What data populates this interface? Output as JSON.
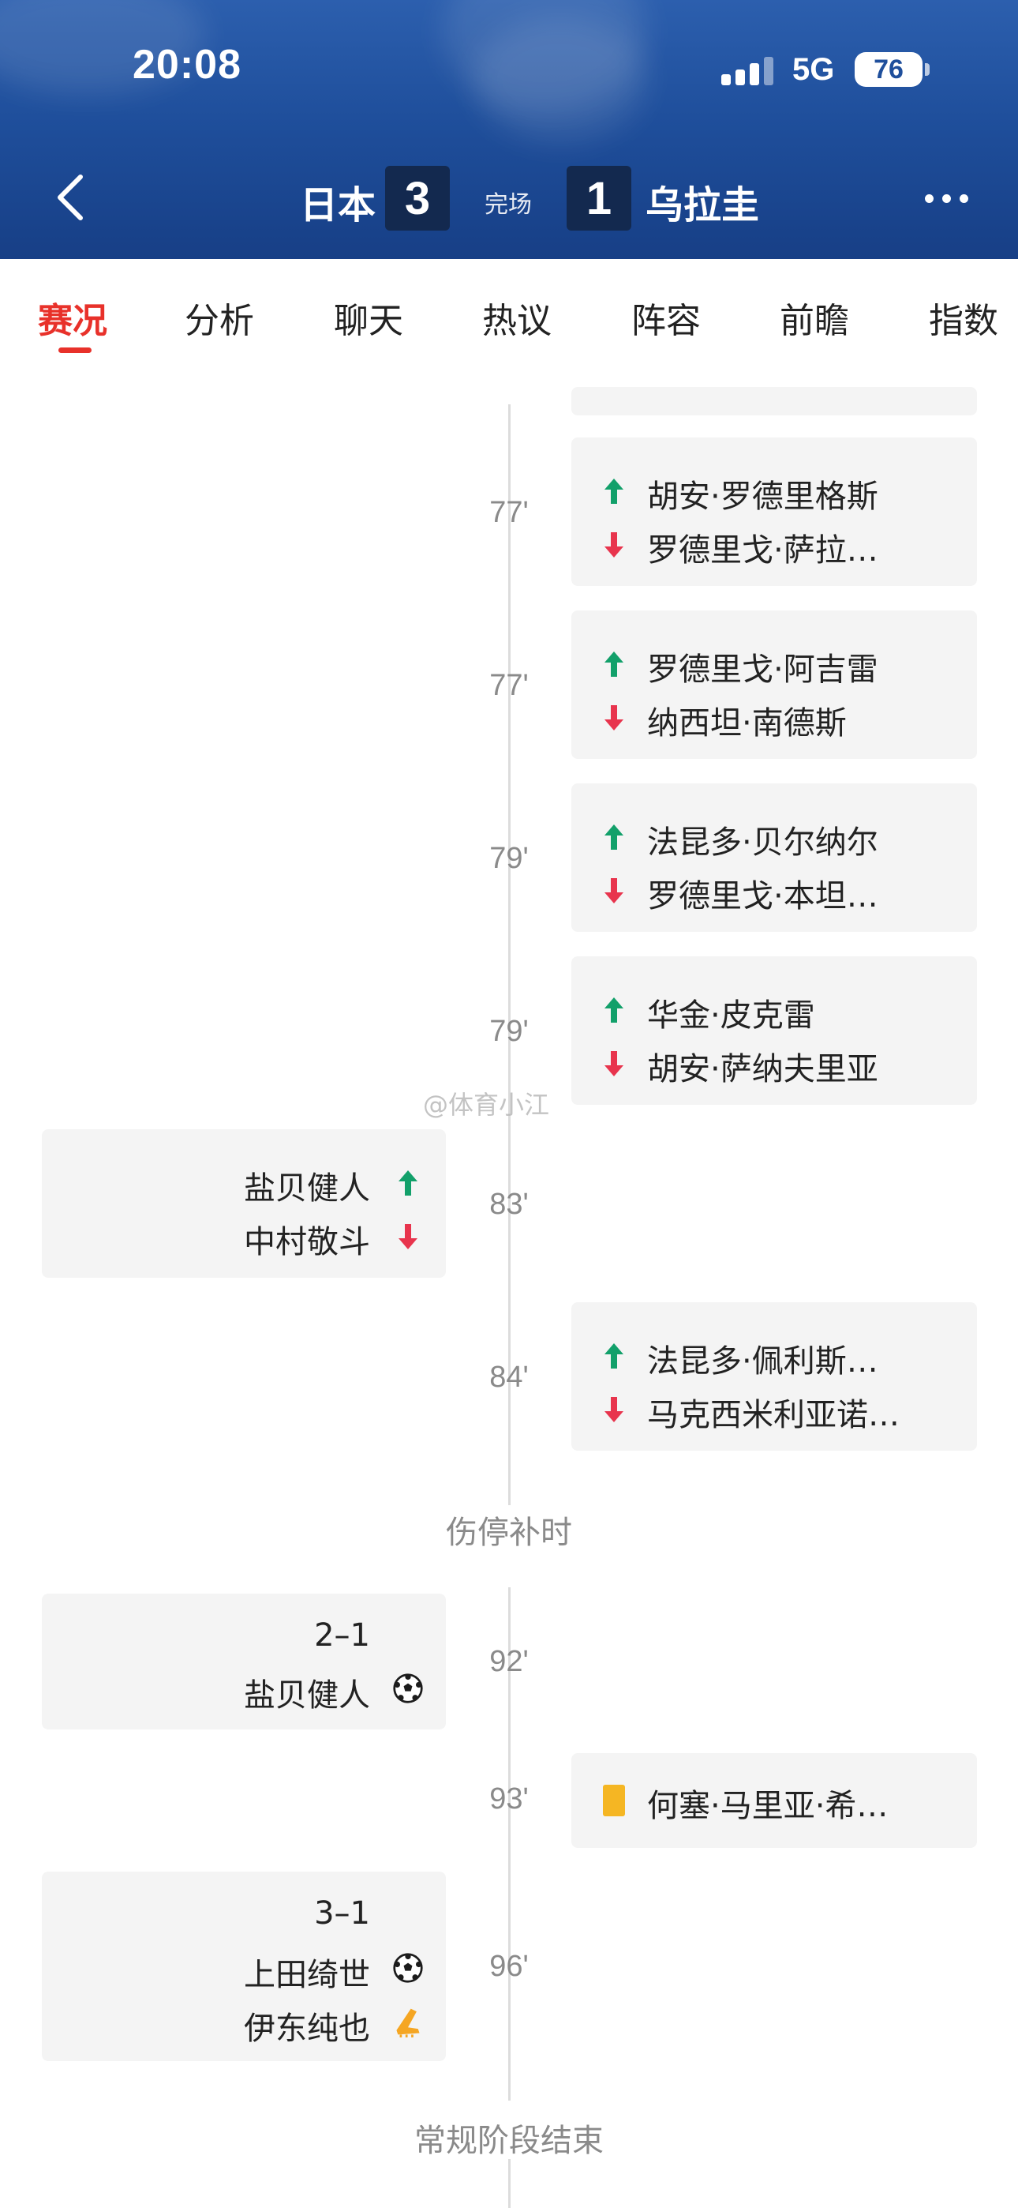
{
  "status_bar": {
    "time": "20:08",
    "network": "5G",
    "battery": "76"
  },
  "match": {
    "home_team": "日本",
    "home_score": "3",
    "status": "完场",
    "away_score": "1",
    "away_team": "乌拉圭"
  },
  "tabs": [
    "赛况",
    "分析",
    "聊天",
    "热议",
    "阵容",
    "前瞻",
    "指数"
  ],
  "watermark": "@体育小江",
  "events": {
    "e77a": {
      "minute": "77'",
      "in": "胡安·罗德里格斯",
      "out": "罗德里戈·萨拉…"
    },
    "e77b": {
      "minute": "77'",
      "in": "罗德里戈·阿吉雷",
      "out": "纳西坦·南德斯"
    },
    "e79a": {
      "minute": "79'",
      "in": "法昆多·贝尔纳尔",
      "out": "罗德里戈·本坦…"
    },
    "e79b": {
      "minute": "79'",
      "in": "华金·皮克雷",
      "out": "胡安·萨纳夫里亚"
    },
    "e83": {
      "minute": "83'",
      "in": "盐贝健人",
      "out": "中村敬斗"
    },
    "e84": {
      "minute": "84'",
      "in": "法昆多·佩利斯…",
      "out": "马克西米利亚诺…"
    },
    "stoppage": "伤停补时",
    "e92": {
      "minute": "92'",
      "score": "2–1",
      "scorer": "盐贝健人"
    },
    "e93": {
      "minute": "93'",
      "player": "何塞·马里亚·希…"
    },
    "e96": {
      "minute": "96'",
      "score": "3–1",
      "scorer": "上田绮世",
      "assist": "伊东纯也"
    },
    "end": "常规阶段结束"
  },
  "colors": {
    "accent_red": "#e8312a",
    "sub_in_green": "#12a06a",
    "sub_out_red": "#e8344d",
    "yellow_card": "#f5b623"
  },
  "icons": [
    "back-chevron-icon",
    "more-dots-icon",
    "arrow-up-icon",
    "arrow-down-icon",
    "soccer-ball-icon",
    "yellow-card-icon",
    "boot-icon"
  ]
}
